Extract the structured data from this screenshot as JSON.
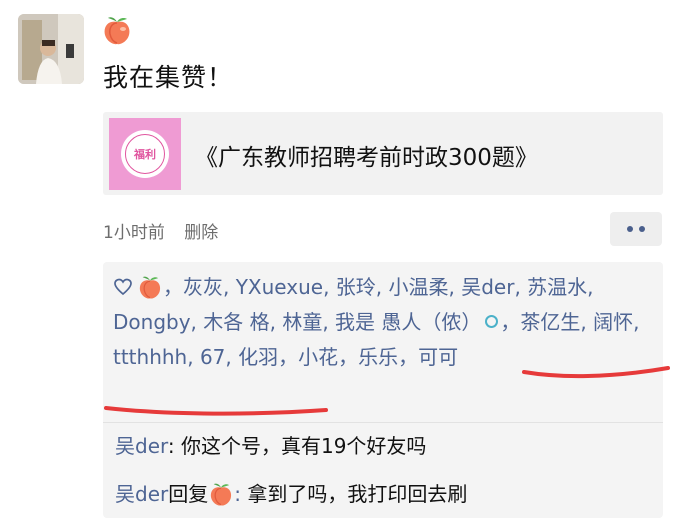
{
  "post": {
    "avatar_icon": "person-photo-icon",
    "header_emoji": "peach-emoji",
    "text": "我在集赞！"
  },
  "share_card": {
    "thumbnail_label": "福利",
    "title": "《广东教师招聘考前时政300题》"
  },
  "meta": {
    "time": "1小时前",
    "delete_label": "删除",
    "more_icon": "more-dots-icon"
  },
  "likes": {
    "icon": "heart-outline-icon",
    "first_liker_emoji": "peach-emoji",
    "sep1": "，",
    "names_part1": "灰灰, YXuexue, 张玲, 小温柔, 吴der, 苏温水, Dongby, 木各  格, 林童, 我是 愚人（侬）",
    "circle_symbol": "circle-icon",
    "names_part2": "，茶亿生, 阔怀, ttthhhh, 67, 化羽，小花，乐乐，可可"
  },
  "comments": [
    {
      "author": "吴der",
      "separator": ": ",
      "text": "你这个号，真有19个好友吗"
    },
    {
      "author": "吴der",
      "reply_word": "回复",
      "reply_to_emoji": "peach-emoji",
      "separator": ": ",
      "text": "拿到了吗，我打印回去刷"
    }
  ],
  "colors": {
    "link_blue": "#4e6594",
    "panel_bg": "#f4f4f4",
    "thumb_pink": "#ef9bd3",
    "annotation_red": "#e63a3a"
  }
}
